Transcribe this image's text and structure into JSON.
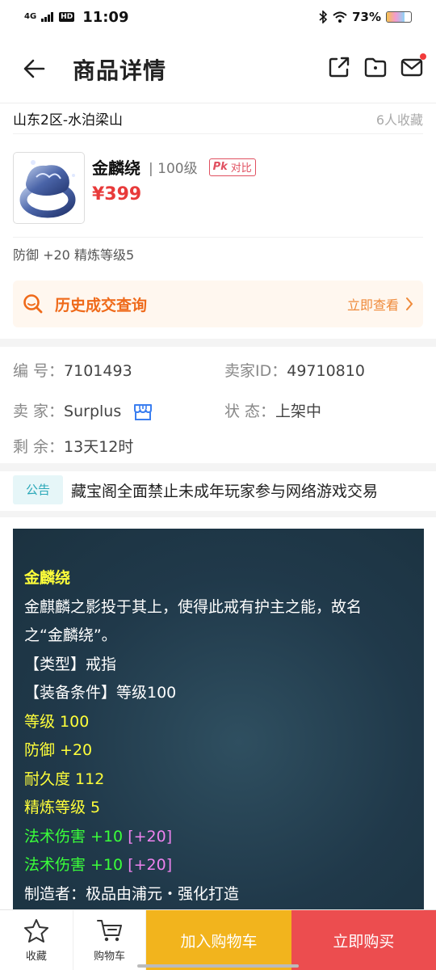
{
  "status_bar": {
    "network": "4G",
    "hd": "HD",
    "time": "11:09",
    "battery": "73%",
    "battery_level": 0.73
  },
  "header": {
    "title": "商品详情"
  },
  "server": {
    "name": "山东2区-水泊梁山",
    "favorites": "6人收藏"
  },
  "product": {
    "name": "金麟绕",
    "level": "| 100级",
    "compare_prefix": "Pk",
    "compare_label": "对比",
    "price": "¥399",
    "attributes": "防御  +20  精炼等级5"
  },
  "history": {
    "label": "历史成交查询",
    "link": "立即查看"
  },
  "info": {
    "id_label": "编    号：",
    "id_value": "7101493",
    "seller_id_label": "卖家ID：",
    "seller_id_value": "49710810",
    "seller_label": "卖    家：",
    "seller_value": "Surplus",
    "status_label": "状    态：",
    "status_value": "上架中",
    "remaining_label": "剩    余：",
    "remaining_value": "13天12时"
  },
  "notice": {
    "tag": "公告",
    "text": "藏宝阁全面禁止未成年玩家参与网络游戏交易"
  },
  "description": {
    "name": "金麟绕",
    "intro_1": "金麒麟之影投于其上，使得此戒有护主之能，故名",
    "intro_2": "之“金麟绕”。",
    "type": "【类型】戒指",
    "requirement": "【装备条件】等级100",
    "level": "等级 100",
    "defense": "防御 +20",
    "durability": "耐久度 112",
    "refine": "精炼等级 5",
    "magic_1": "法术伤害 +10",
    "magic_1_extra": "[+20]",
    "magic_2": "法术伤害 +10",
    "magic_2_extra": "[+20]",
    "maker": "制造者：极品由浦元・强化打造"
  },
  "bottom_bar": {
    "favorite": "收藏",
    "cart": "购物车",
    "add_to_cart": "加入购物车",
    "buy_now": "立即购买"
  },
  "colors": {
    "price": "#e83a3a",
    "history_accent": "#ef6a1a",
    "cart_button": "#f2b41d",
    "buy_button": "#ec4d4f",
    "desc_bg": "#20394a"
  }
}
